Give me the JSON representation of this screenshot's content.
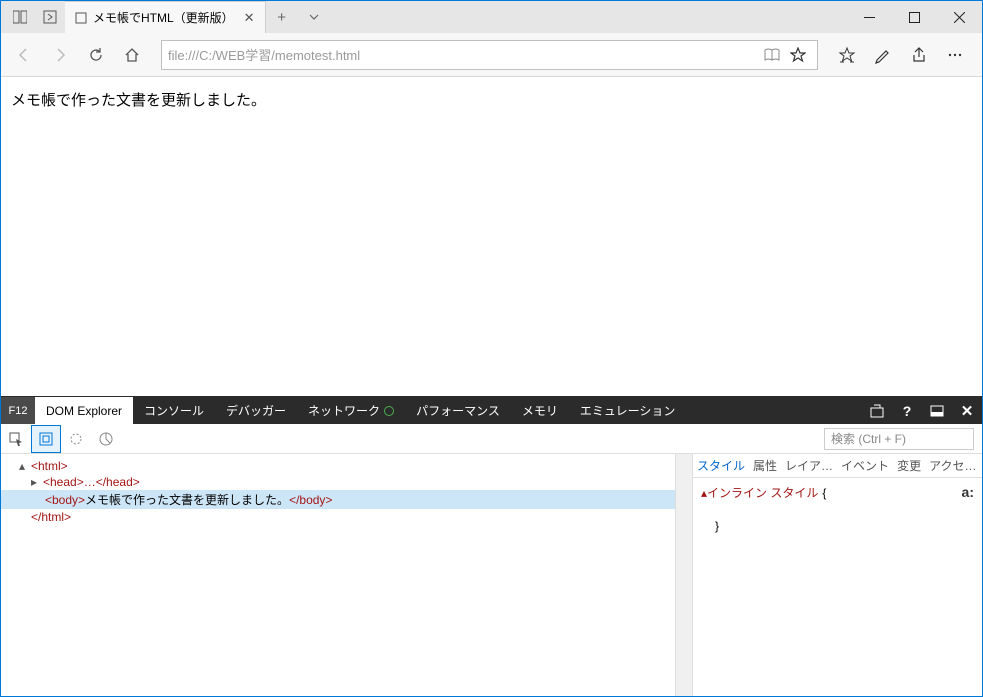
{
  "window": {
    "tab_title": "メモ帳でHTML（更新版）",
    "url": "file:///C:/WEB学習/memotest.html"
  },
  "page": {
    "body_text": "メモ帳で作った文書を更新しました。"
  },
  "devtools": {
    "f12_label": "F12",
    "tabs": {
      "dom": "DOM Explorer",
      "console": "コンソール",
      "debugger": "デバッガー",
      "network": "ネットワーク",
      "performance": "パフォーマンス",
      "memory": "メモリ",
      "emulation": "エミュレーション"
    },
    "search_placeholder": "検索 (Ctrl + F)",
    "dom": {
      "open_html": "<html>",
      "open_head": "<head>",
      "head_dots": "…",
      "close_head": "</head>",
      "open_body": "<body>",
      "body_text": "メモ帳で作った文書を更新しました。",
      "close_body": "</body>",
      "close_html": "</html>"
    },
    "styles": {
      "tabs": {
        "style": "スタイル",
        "attr": "属性",
        "layout": "レイア…",
        "event": "イベント",
        "change": "変更",
        "access": "アクセ…"
      },
      "inline_label": "インライン スタイル",
      "open_brace": "{",
      "close_brace": "}",
      "pseudo": "a:"
    }
  }
}
